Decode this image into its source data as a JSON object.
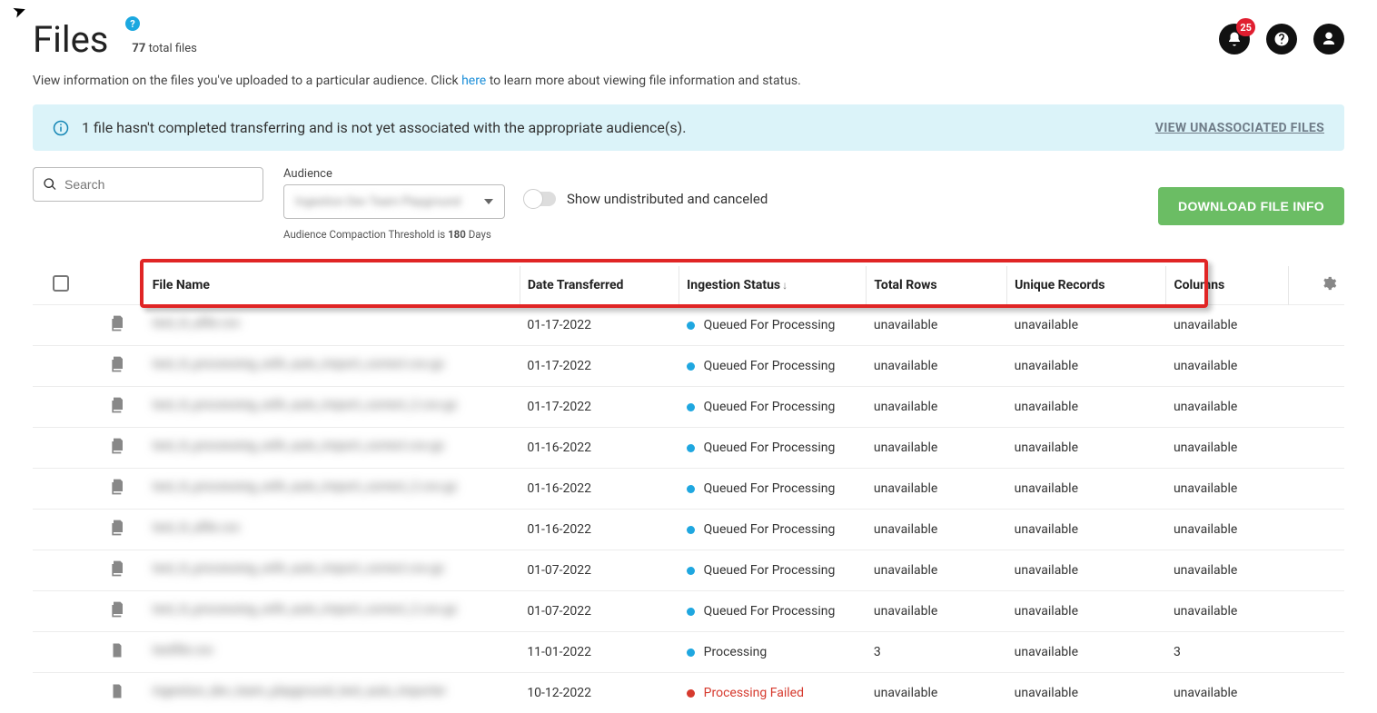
{
  "header": {
    "title": "Files",
    "help_badge": "?",
    "file_count": "77",
    "file_count_suffix": "total files",
    "notification_count": "25"
  },
  "description": {
    "pre": "View information on the files you've uploaded to a particular audience. Click ",
    "link": "here",
    "post": " to learn more about viewing file information and status."
  },
  "banner": {
    "text": "1 file hasn't completed transferring and is not yet associated with the appropriate audience(s).",
    "action": "VIEW UNASSOCIATED FILES"
  },
  "controls": {
    "search_placeholder": "Search",
    "audience_label": "Audience",
    "audience_value": "Ingestion Dev Team Playground",
    "compaction_pre": "Audience Compaction Threshold is ",
    "compaction_days": "180",
    "compaction_post": " Days",
    "toggle_label": "Show undistributed and canceled",
    "download_label": "DOWNLOAD FILE INFO"
  },
  "table": {
    "headers": {
      "file_name": "File Name",
      "date": "Date Transferred",
      "status": "Ingestion Status",
      "total_rows": "Total Rows",
      "unique": "Unique Records",
      "columns": "Columns"
    },
    "rows": [
      {
        "icon": "multi",
        "name": "test_tt_afile.csv",
        "date": "01-17-2022",
        "status": "Queued For Processing",
        "status_color": "blue",
        "total": "unavailable",
        "unique": "unavailable",
        "cols": "unavailable"
      },
      {
        "icon": "multi",
        "name": "test_tt_processing_with_auto_import_correct.csv.gz",
        "date": "01-17-2022",
        "status": "Queued For Processing",
        "status_color": "blue",
        "total": "unavailable",
        "unique": "unavailable",
        "cols": "unavailable"
      },
      {
        "icon": "multi",
        "name": "test_tt_processing_with_auto_import_correct_2.csv.gz",
        "date": "01-17-2022",
        "status": "Queued For Processing",
        "status_color": "blue",
        "total": "unavailable",
        "unique": "unavailable",
        "cols": "unavailable"
      },
      {
        "icon": "multi",
        "name": "test_tt_processing_with_auto_import_correct.csv.gz",
        "date": "01-16-2022",
        "status": "Queued For Processing",
        "status_color": "blue",
        "total": "unavailable",
        "unique": "unavailable",
        "cols": "unavailable"
      },
      {
        "icon": "multi",
        "name": "test_tt_processing_with_auto_import_correct_2.csv.gz",
        "date": "01-16-2022",
        "status": "Queued For Processing",
        "status_color": "blue",
        "total": "unavailable",
        "unique": "unavailable",
        "cols": "unavailable"
      },
      {
        "icon": "multi",
        "name": "test_tt_afile.csv",
        "date": "01-16-2022",
        "status": "Queued For Processing",
        "status_color": "blue",
        "total": "unavailable",
        "unique": "unavailable",
        "cols": "unavailable"
      },
      {
        "icon": "multi",
        "name": "test_tt_processing_with_auto_import_correct.csv.gz",
        "date": "01-07-2022",
        "status": "Queued For Processing",
        "status_color": "blue",
        "total": "unavailable",
        "unique": "unavailable",
        "cols": "unavailable"
      },
      {
        "icon": "multi",
        "name": "test_tt_processing_with_auto_import_correct_2.csv.gz",
        "date": "01-07-2022",
        "status": "Queued For Processing",
        "status_color": "blue",
        "total": "unavailable",
        "unique": "unavailable",
        "cols": "unavailable"
      },
      {
        "icon": "single",
        "name": "testfile.csv",
        "date": "11-01-2022",
        "status": "Processing",
        "status_color": "blue",
        "total": "3",
        "unique": "unavailable",
        "cols": "3"
      },
      {
        "icon": "single",
        "name": "ingestion_dev_team_playground_test_auto_importer",
        "date": "10-12-2022",
        "status": "Processing Failed",
        "status_color": "red",
        "total": "unavailable",
        "unique": "unavailable",
        "cols": "unavailable"
      }
    ]
  }
}
